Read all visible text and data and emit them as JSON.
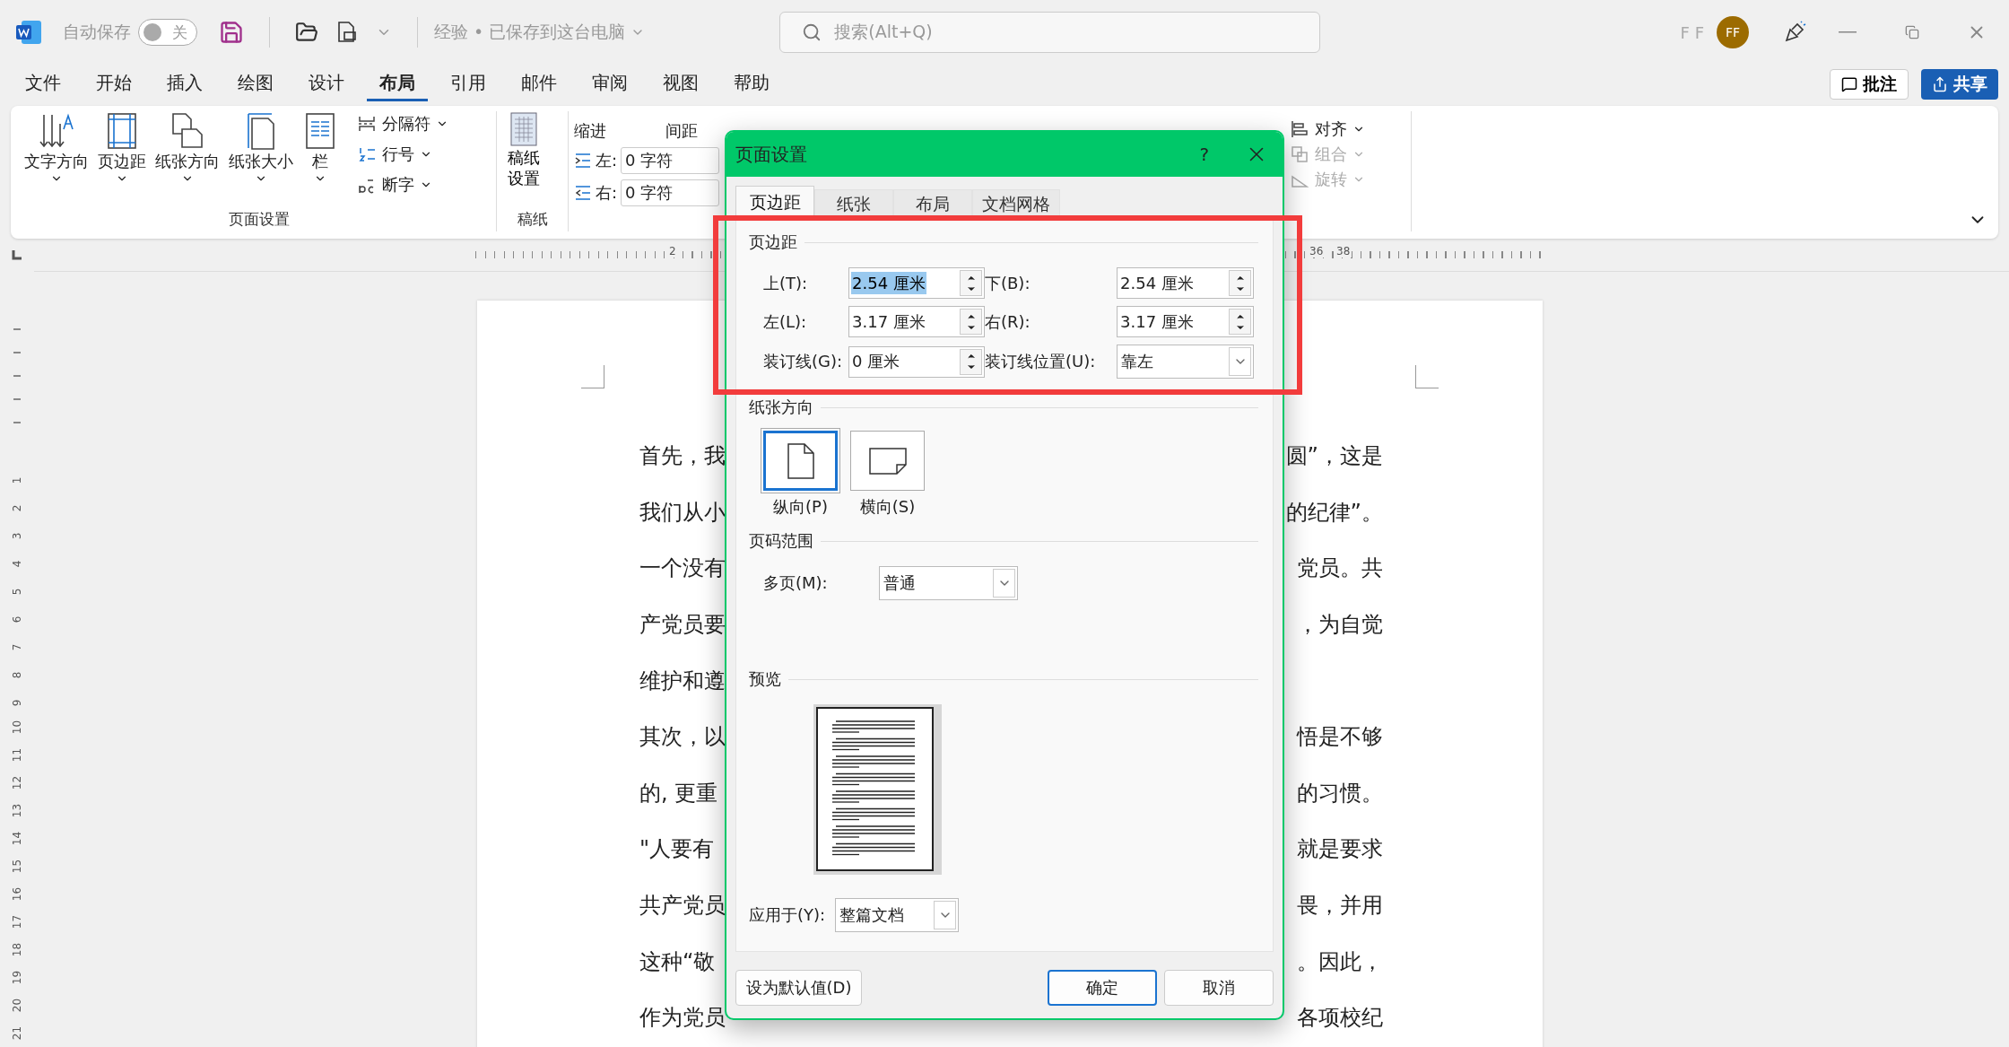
{
  "titlebar": {
    "autosave_label": "自动保存",
    "autosave_toggle": {
      "label": "关",
      "on": false
    },
    "doc_title": "经验 • 已保存到这台电脑",
    "search": {
      "placeholder": "搜索(Alt+Q)"
    },
    "user_initials": "F F",
    "avatar": "FF"
  },
  "menu_tabs": [
    {
      "label": "文件",
      "selected": false
    },
    {
      "label": "开始",
      "selected": false
    },
    {
      "label": "插入",
      "selected": false
    },
    {
      "label": "绘图",
      "selected": false
    },
    {
      "label": "设计",
      "selected": false
    },
    {
      "label": "布局",
      "selected": true
    },
    {
      "label": "引用",
      "selected": false
    },
    {
      "label": "邮件",
      "selected": false
    },
    {
      "label": "审阅",
      "selected": false
    },
    {
      "label": "视图",
      "selected": false
    },
    {
      "label": "帮助",
      "selected": false
    }
  ],
  "actions": {
    "comment": "批注",
    "share": "共享"
  },
  "ribbon": {
    "page_setup": {
      "big_buttons": [
        {
          "label": "文字方向",
          "kind": "text-direction"
        },
        {
          "label": "页边距",
          "kind": "margins"
        },
        {
          "label": "纸张方向",
          "kind": "orientation"
        },
        {
          "label": "纸张大小",
          "kind": "size"
        },
        {
          "label": "栏",
          "kind": "columns"
        }
      ],
      "small_buttons": [
        {
          "label": "分隔符",
          "kind": "breaks"
        },
        {
          "label": "行号",
          "kind": "line-numbers"
        },
        {
          "label": "断字",
          "kind": "hyphenation"
        }
      ],
      "group_label": "页面设置"
    },
    "manuscript": {
      "button": "稿纸设置",
      "group_label": "稿纸"
    },
    "indent": {
      "title": "缩进",
      "fields": [
        {
          "label": "左:",
          "value": "0 字符",
          "kind": "left"
        },
        {
          "label": "右:",
          "value": "0 字符",
          "kind": "right"
        }
      ]
    },
    "spacing": {
      "title": "间距"
    },
    "arrange": [
      {
        "label": "对齐",
        "disabled": false,
        "kind": "align"
      },
      {
        "label": "组合",
        "disabled": true,
        "kind": "group"
      },
      {
        "label": "旋转",
        "disabled": true,
        "kind": "rotate"
      }
    ]
  },
  "ruler": {
    "top_numbers": [
      "2",
      "36",
      "38"
    ],
    "left_numbers": [
      "1",
      "2",
      "3",
      "4",
      "5",
      "6",
      "7",
      "8",
      "9",
      "10",
      "11",
      "12",
      "13",
      "14",
      "15",
      "16",
      "17",
      "18",
      "19",
      "20",
      "21"
    ]
  },
  "document": {
    "lines": [
      {
        "left": "首先，我",
        "right": "圆”，这是"
      },
      {
        "left": "我们从小",
        "right": "的纪律”。"
      },
      {
        "left": "一个没有",
        "right": "党员。共"
      },
      {
        "left": "产党员要",
        "right": "，为自觉"
      },
      {
        "left": "维护和遵"
      },
      {
        "left": "其次，以",
        "right": "悟是不够"
      },
      {
        "left": "的, 更重",
        "right": "的习惯。"
      },
      {
        "left": "\"人要有",
        "right": "就是要求"
      },
      {
        "left": "共产党员",
        "right": "畏，并用"
      },
      {
        "left": "这种“敬",
        "right": "。因此，"
      },
      {
        "left": "作为党员",
        "right": "各项校纪"
      }
    ]
  },
  "dialog": {
    "title": "页面设置",
    "help": "?",
    "tabs": [
      {
        "label": "页边距",
        "selected": true
      },
      {
        "label": "纸张",
        "selected": false
      },
      {
        "label": "布局",
        "selected": false
      },
      {
        "label": "文档网格",
        "selected": false
      }
    ],
    "margins": {
      "title": "页边距",
      "fields": [
        {
          "label": "上(T):",
          "value": "2.54 厘米",
          "kind": "spin",
          "selected": true
        },
        {
          "label": "下(B):",
          "value": "2.54 厘米",
          "kind": "spin",
          "selected": false
        },
        {
          "label": "左(L):",
          "value": "3.17 厘米",
          "kind": "spin",
          "selected": false
        },
        {
          "label": "右(R):",
          "value": "3.17 厘米",
          "kind": "spin",
          "selected": false
        },
        {
          "label": "装订线(G):",
          "value": "0 厘米",
          "kind": "spin",
          "selected": false
        },
        {
          "label": "装订线位置(U):",
          "value": "靠左",
          "kind": "select"
        }
      ]
    },
    "orientation": {
      "title": "纸张方向",
      "options": [
        {
          "label": "纵向(P)",
          "kind": "portrait",
          "selected": true
        },
        {
          "label": "横向(S)",
          "kind": "landscape",
          "selected": false
        }
      ]
    },
    "pages": {
      "title": "页码范围",
      "label": "多页(M):",
      "value": "普通"
    },
    "preview": {
      "title": "预览"
    },
    "apply": {
      "label": "应用于(Y):",
      "value": "整篇文档"
    },
    "buttons": {
      "default": "设为默认值(D)",
      "ok": "确定",
      "cancel": "取消"
    }
  }
}
